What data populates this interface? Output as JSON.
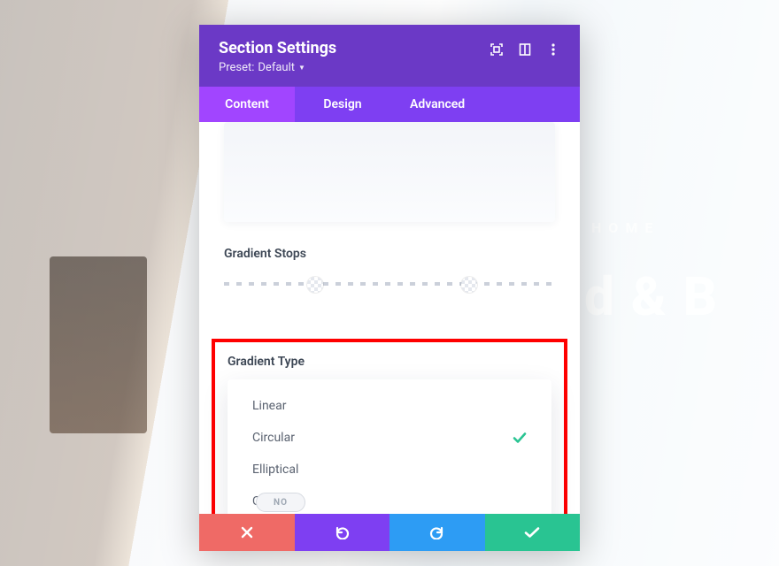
{
  "header": {
    "title": "Section Settings",
    "preset_prefix": "Preset:",
    "preset_name": "Default"
  },
  "tabs": {
    "content": "Content",
    "design": "Design",
    "advanced": "Advanced",
    "active": "content"
  },
  "body": {
    "gradient_stops_label": "Gradient Stops",
    "gradient_type_label": "Gradient Type",
    "gradient_type_options": [
      {
        "label": "Linear",
        "selected": false
      },
      {
        "label": "Circular",
        "selected": true
      },
      {
        "label": "Elliptical",
        "selected": false
      },
      {
        "label": "Conical",
        "selected": false
      }
    ],
    "toggle_label": "NO"
  },
  "bg": {
    "tagline": "HOME",
    "headline": "d & B"
  }
}
